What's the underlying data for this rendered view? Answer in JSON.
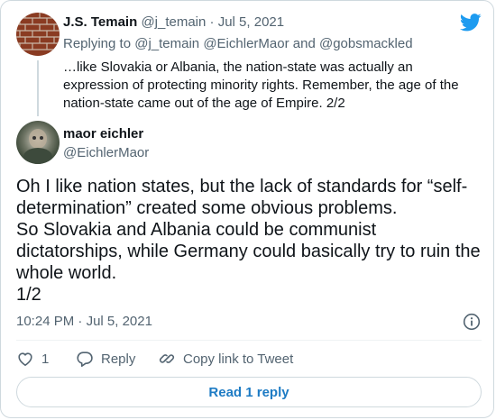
{
  "quoted": {
    "name": "J.S. Temain",
    "handle": "@j_temain",
    "separator": "·",
    "date": "Jul 5, 2021",
    "replying_prefix": "Replying to",
    "replying_handle1": "@j_temain",
    "replying_handle2": "@EichlerMaor",
    "replying_and": "and",
    "replying_handle3": "@gobsmackled",
    "text_lines": [
      "…like Slovakia or Albania, the nation-state was actually an",
      "expression of protecting minority rights. Remember, the age of the",
      "nation-state came out of the age of Empire. 2/2"
    ]
  },
  "tweet": {
    "name": "maor eichler",
    "handle": "@EichlerMaor",
    "text_lines": [
      "Oh I like nation states, but the lack of standards for “self-",
      "determination” created some obvious problems.",
      "So Slovakia and Albania could be communist",
      "dictatorships, while Germany could basically try to ruin the",
      "whole world.",
      "1/2"
    ],
    "time": "10:24 PM",
    "separator": "·",
    "date": "Jul 5, 2021"
  },
  "actions": {
    "like_count": "1",
    "reply_label": "Reply",
    "copy_link_label": "Copy link to Tweet"
  },
  "read_replies_label": "Read 1 reply",
  "icons": {
    "brand": "twitter-bird-icon",
    "info": "info-icon",
    "like": "heart-icon",
    "reply": "reply-bubble-icon",
    "copy": "link-icon"
  },
  "colors": {
    "twitter_blue": "#1d9bf0",
    "link_blue": "#1d7bc4",
    "muted_text": "#536471",
    "border": "#cfd9de"
  }
}
